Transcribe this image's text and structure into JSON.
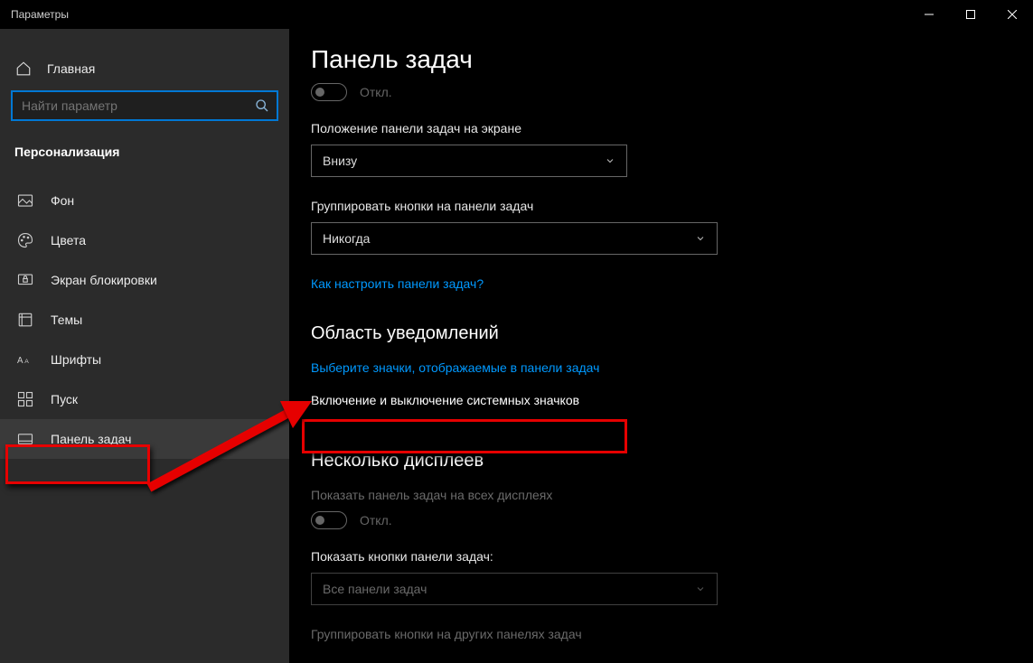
{
  "window": {
    "title": "Параметры"
  },
  "sidebar": {
    "home": "Главная",
    "search_placeholder": "Найти параметр",
    "section": "Персонализация",
    "items": [
      {
        "label": "Фон"
      },
      {
        "label": "Цвета"
      },
      {
        "label": "Экран блокировки"
      },
      {
        "label": "Темы"
      },
      {
        "label": "Шрифты"
      },
      {
        "label": "Пуск"
      },
      {
        "label": "Панель задач"
      }
    ]
  },
  "content": {
    "page_title": "Панель задач",
    "toggle1_state": "Откл.",
    "position_label": "Положение панели задач на экране",
    "position_value": "Внизу",
    "group_label": "Группировать кнопки на панели задач",
    "group_value": "Никогда",
    "help_link": "Как настроить панели задач?",
    "notif_heading": "Область уведомлений",
    "notif_link1": "Выберите значки, отображаемые в панели задач",
    "notif_link2": "Включение и выключение системных значков",
    "multi_heading": "Несколько дисплеев",
    "multi_toggle_label": "Показать панель задач на всех дисплеях",
    "multi_toggle_state": "Откл.",
    "show_buttons_label": "Показать кнопки панели задач:",
    "show_buttons_value": "Все панели задач",
    "group_other_label": "Группировать кнопки на других панелях задач"
  }
}
